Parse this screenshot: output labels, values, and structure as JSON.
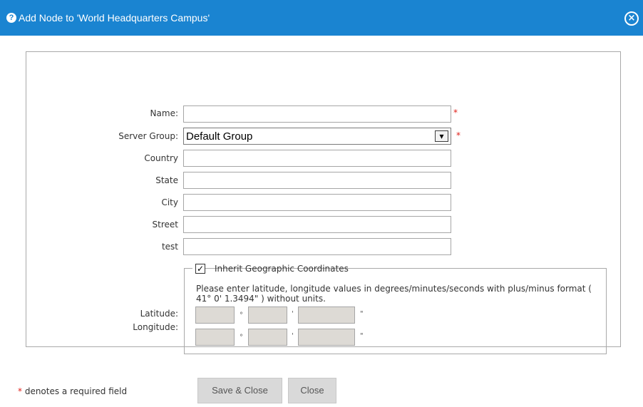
{
  "dialog": {
    "title": "Add Node to 'World Headquarters Campus'",
    "help_icon": "?",
    "close_icon": "×"
  },
  "form": {
    "name": {
      "label": "Name:",
      "value": "",
      "required_mark": "*"
    },
    "server_group": {
      "label": "Server Group:",
      "value": "Default Group",
      "arrow": "▾",
      "required_mark": "*"
    },
    "country": {
      "label": "Country",
      "value": ""
    },
    "state": {
      "label": "State",
      "value": ""
    },
    "city": {
      "label": "City",
      "value": ""
    },
    "street": {
      "label": "Street",
      "value": ""
    },
    "test": {
      "label": "test",
      "value": ""
    }
  },
  "coordinates": {
    "inherit_label": "Inherit Geographic Coordinates",
    "inherit_checked": true,
    "check_glyph": "✓",
    "hint": "Please enter latitude, longitude values in degrees/minutes/seconds with plus/minus format ( 41° 0' 1.3494\" ) without units.",
    "latitude_label": "Latitude:",
    "longitude_label": "Longitude:",
    "degree_unit": "°",
    "minute_unit": "'",
    "second_unit": "\"",
    "latitude": {
      "degrees": "",
      "minutes": "",
      "seconds": ""
    },
    "longitude": {
      "degrees": "",
      "minutes": "",
      "seconds": ""
    }
  },
  "footer": {
    "required_mark": "*",
    "required_note": "denotes a required field",
    "save_close_label": "Save & Close",
    "close_label": "Close"
  },
  "colors": {
    "title_bar": "#1a84d1",
    "required": "#e0201a",
    "disabled_field": "#dddad5",
    "button": "#d9d9d9"
  }
}
